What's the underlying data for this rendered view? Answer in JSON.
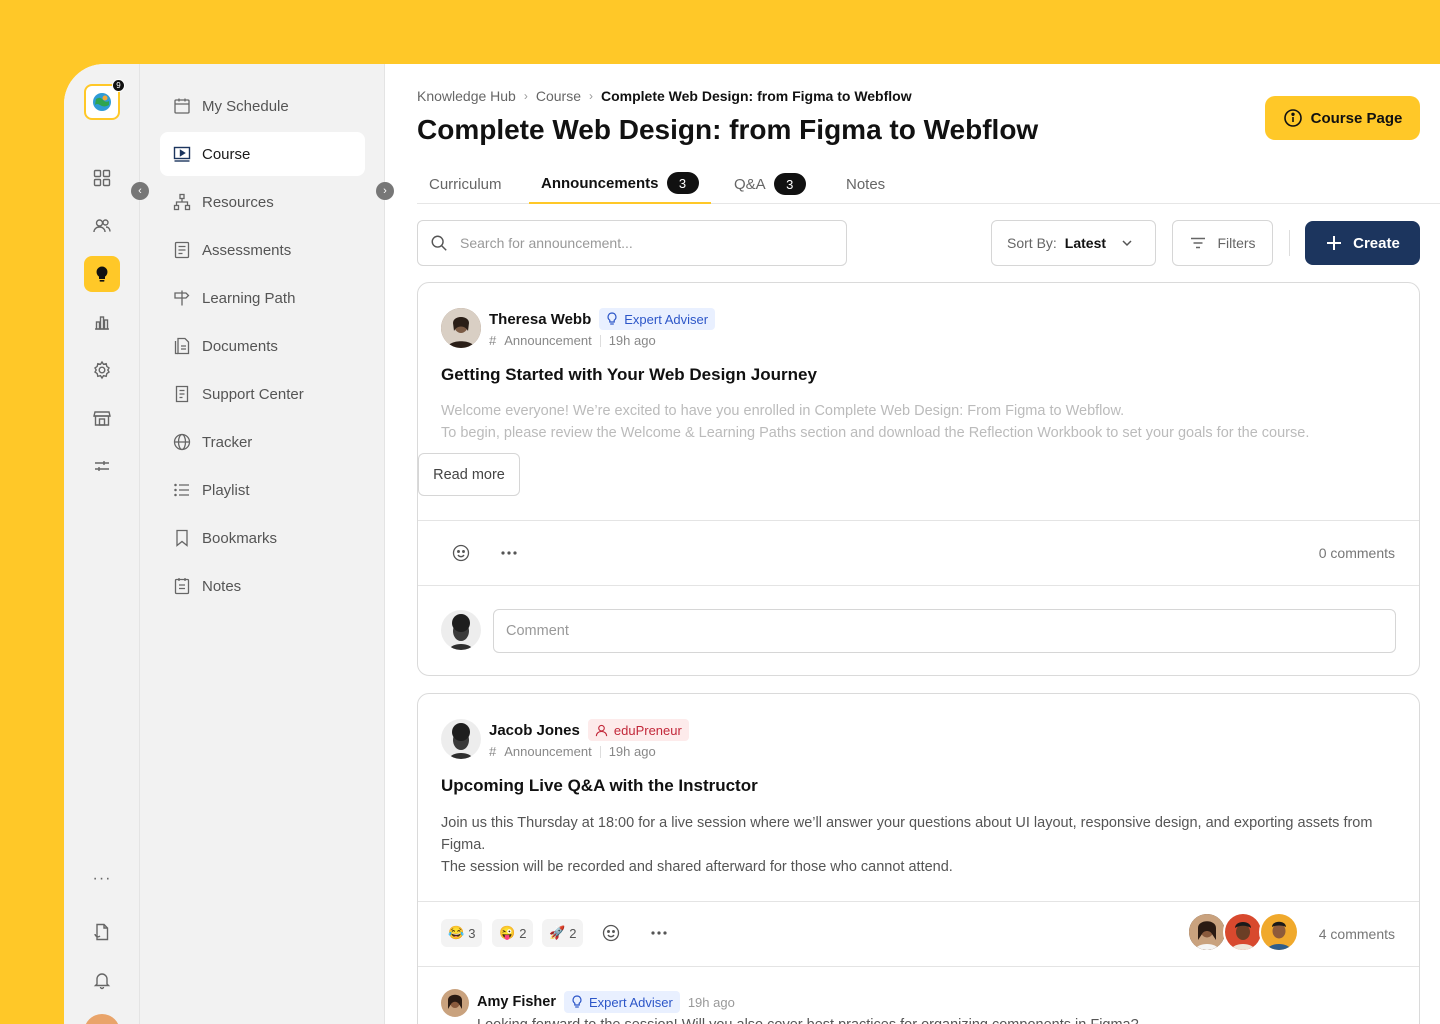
{
  "rail": {
    "notification_count": "9",
    "more": "···"
  },
  "sidebar": {
    "items": [
      {
        "label": "My Schedule"
      },
      {
        "label": "Course"
      },
      {
        "label": "Resources"
      },
      {
        "label": "Assessments"
      },
      {
        "label": "Learning Path"
      },
      {
        "label": "Documents"
      },
      {
        "label": "Support Center"
      },
      {
        "label": "Tracker"
      },
      {
        "label": "Playlist"
      },
      {
        "label": "Bookmarks"
      },
      {
        "label": "Notes"
      }
    ]
  },
  "breadcrumb": [
    "Knowledge Hub",
    "Course",
    "Complete Web Design: from Figma to Webflow"
  ],
  "header": {
    "title": "Complete Web Design: from Figma to Webflow",
    "course_page_label": "Course Page"
  },
  "tabs": [
    {
      "label": "Curriculum"
    },
    {
      "label": "Announcements",
      "count": "3"
    },
    {
      "label": "Q&A",
      "count": "3"
    },
    {
      "label": "Notes"
    }
  ],
  "toolbar": {
    "search_placeholder": "Search for announcement...",
    "sort_label": "Sort By:",
    "sort_value": "Latest",
    "filters_label": "Filters",
    "create_label": "Create"
  },
  "posts": [
    {
      "author": "Theresa Webb",
      "role": "Expert Adviser",
      "category": "Announcement",
      "time": "19h ago",
      "title": "Getting Started with Your Web Design Journey",
      "body_line1": "Welcome everyone! We’re excited to have you enrolled in Complete Web Design: From Figma to Webflow.",
      "body_line2": "To begin, please review the Welcome & Learning Paths section and download the Reflection Workbook to set your goals for the course.",
      "read_more": "Read more",
      "comments": "0 comments",
      "comment_placeholder": "Comment"
    },
    {
      "author": "Jacob Jones",
      "role": "eduPreneur",
      "category": "Announcement",
      "time": "19h ago",
      "title": "Upcoming Live Q&A with the Instructor",
      "body_line1": "Join us this Thursday at 18:00 for a live session where we’ll answer your questions about UI layout, responsive design, and exporting assets from Figma.",
      "body_line2": "The session will be recorded and shared afterward for those who cannot attend.",
      "reactions": [
        {
          "emoji": "😂",
          "count": "3"
        },
        {
          "emoji": "😜",
          "count": "2"
        },
        {
          "emoji": "🚀",
          "count": "2"
        }
      ],
      "comments": "4 comments",
      "reply": {
        "author": "Amy Fisher",
        "role": "Expert Adviser",
        "time": "19h ago",
        "text": "Looking forward to the session! Will you also cover best practices for organizing components in Figma?"
      }
    }
  ],
  "colors": {
    "accent": "#FFC828",
    "primary": "#1C355E"
  }
}
